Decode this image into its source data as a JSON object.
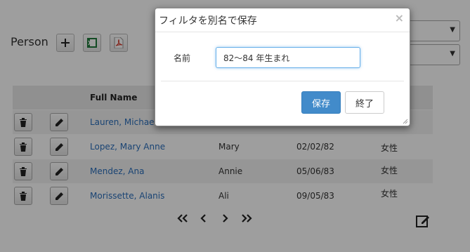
{
  "page": {
    "title": "Person"
  },
  "toolbar": {
    "add_icon": "plus-icon",
    "excel_icon": "excel-icon",
    "pdf_icon": "pdf-icon"
  },
  "grid": {
    "columns": [
      "Full Name"
    ],
    "rows": [
      {
        "name": "Lauren, Michael",
        "first": "",
        "date": "",
        "gender": ""
      },
      {
        "name": "Lopez, Mary Anne",
        "first": "Mary",
        "date": "02/02/82",
        "gender": "女性"
      },
      {
        "name": "Mendez, Ana",
        "first": "Annie",
        "date": "05/06/83",
        "gender": "女性"
      },
      {
        "name": "Morissette, Alanis",
        "first": "Ali",
        "date": "09/05/83",
        "gender": "女性"
      }
    ],
    "pager": {
      "first": "«",
      "prev": "‹",
      "next": "›",
      "last": "»"
    }
  },
  "modal": {
    "title": "フィルタを別名で保存",
    "close": "×",
    "field_label": "名前",
    "field_value": "82〜84 年生まれ",
    "save_label": "保存",
    "close_label": "終了"
  },
  "colors": {
    "primary": "#428bca",
    "link": "#2a6ebb",
    "excel": "#1f7a3a",
    "pdf": "#d33a2c"
  }
}
